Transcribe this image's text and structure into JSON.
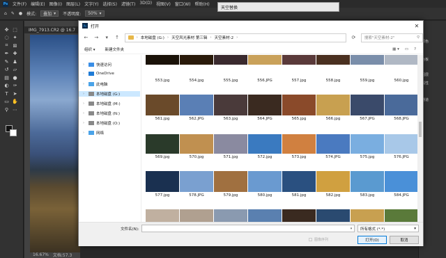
{
  "ps": {
    "menu": [
      "文件(F)",
      "编辑(E)",
      "图像(I)",
      "图层(L)",
      "文字(Y)",
      "选择(S)",
      "滤镜(T)",
      "3D(D)",
      "视图(V)",
      "窗口(W)",
      "帮助(H)"
    ],
    "opt": {
      "mode_label": "模式:",
      "mode_value": "叠加",
      "opacity_label": "不透明度:",
      "opacity_value": "50%"
    },
    "doc_tab": "IMG_7913.CR2 @ 16.7",
    "status_zoom": "16.67%",
    "status_doc": "文档:57.3",
    "right_panel": [
      "颜色",
      "色板",
      "图层",
      "属性",
      "通道"
    ]
  },
  "sky_panel": {
    "title": "天空替换"
  },
  "dialog": {
    "title": "打开",
    "address": [
      "本地磁盘 (G:)",
      "天空风光素材 第三辑",
      "天空素材-2"
    ],
    "search_placeholder": "搜索\"天空素材-2\"",
    "organize": "组织 ▾",
    "new_folder": "新建文件夹",
    "nav": [
      {
        "label": "快速访问",
        "icon": "star",
        "color": "#3a8ee6"
      },
      {
        "label": "OneDrive",
        "icon": "cloud",
        "color": "#1e7bd6"
      },
      {
        "label": "此电脑",
        "icon": "computer",
        "color": "#4aa3e8"
      },
      {
        "label": "本地磁盘 (G:)",
        "icon": "drive",
        "color": "#888888",
        "selected": true
      },
      {
        "label": "本地磁盘 (M:)",
        "icon": "drive",
        "color": "#888888"
      },
      {
        "label": "本地磁盘 (N:)",
        "icon": "drive",
        "color": "#888888"
      },
      {
        "label": "本地磁盘 (O:)",
        "icon": "drive",
        "color": "#888888"
      },
      {
        "label": "网络",
        "icon": "network",
        "color": "#4aa3e8"
      }
    ],
    "files": [
      [
        "553.jpg",
        "554.jpg",
        "555.jpg",
        "556.JPG",
        "557.jpg",
        "558.jpg",
        "559.jpg",
        "560.jpg"
      ],
      [
        "561.jpg",
        "562.JPG",
        "563.jpg",
        "564.JPG",
        "565.jpg",
        "566.jpg",
        "567.JPG",
        "568.JPG"
      ],
      [
        "569.jpg",
        "570.jpg",
        "571.jpg",
        "572.jpg",
        "573.jpg",
        "574.JPG",
        "575.jpg",
        "576.JPG"
      ],
      [
        "577.jpg",
        "578.JPG",
        "579.jpg",
        "580.jpg",
        "581.jpg",
        "582.jpg",
        "583.jpg",
        "584.JPG"
      ],
      [
        "",
        "",
        "",
        "",
        "",
        "",
        "",
        ""
      ]
    ],
    "thumb_colors": [
      [
        "#1a1208",
        "#2a1a0a",
        "#3a2a2e",
        "#c9a15a",
        "#5a3a3a",
        "#4a3020",
        "#7a8eaa",
        "#b0b8c4"
      ],
      [
        "#6a4a2a",
        "#5a7fb5",
        "#4a3a3a",
        "#3a2a20",
        "#8a4a2a",
        "#c8a050",
        "#3a4a6a",
        "#4a6a9a"
      ],
      [
        "#2a3a2a",
        "#c09050",
        "#8a8aa0",
        "#3a7ac0",
        "#d08040",
        "#4a7ac0",
        "#7aaee0",
        "#a8c8e8"
      ],
      [
        "#1a3050",
        "#7aa0d0",
        "#a07040",
        "#6a9ad0",
        "#2a5080",
        "#d0a040",
        "#5a9ad0",
        "#4a90d8"
      ],
      [
        "#c0b0a0",
        "#b0a090",
        "#8a9ab0",
        "#5a80b0",
        "#3a2a20",
        "#2a4a70",
        "#c8a050",
        "#5a7a3a"
      ]
    ],
    "filename_label": "文件名(N):",
    "filter": "所有格式 (*.*)",
    "image_sequence": "图像序列",
    "open": "打开(O)",
    "cancel": "取消"
  }
}
